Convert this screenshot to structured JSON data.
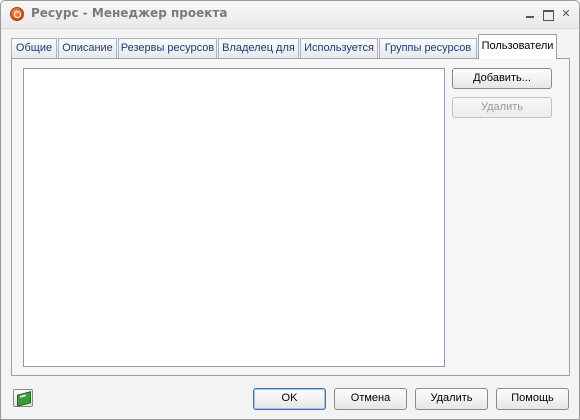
{
  "window": {
    "title": "Ресурс - Менеджер проекта",
    "accent_color": "#d34a0c"
  },
  "tabs": [
    {
      "label": "Общие",
      "active": false
    },
    {
      "label": "Описание",
      "active": false
    },
    {
      "label": "Резервы ресурсов",
      "active": false
    },
    {
      "label": "Владелец для",
      "active": false
    },
    {
      "label": "Используется",
      "active": false
    },
    {
      "label": "Группы ресурсов",
      "active": false
    },
    {
      "label": "Пользователи",
      "active": true
    }
  ],
  "users_panel": {
    "add_label": "Добавить...",
    "remove_label": "Удалить",
    "remove_enabled": false,
    "users": []
  },
  "footer": {
    "icon": "book-icon",
    "ok_label": "OK",
    "cancel_label": "Отмена",
    "delete_label": "Удалить",
    "help_label": "Помощь"
  }
}
